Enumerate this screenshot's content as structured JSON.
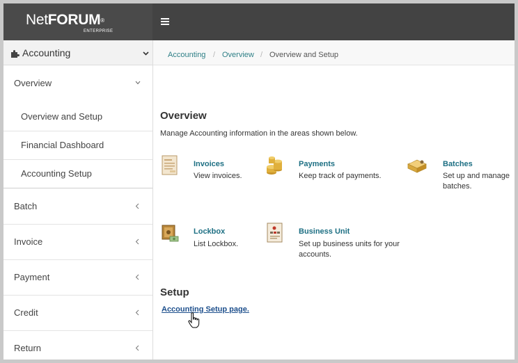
{
  "app": {
    "logo_net": "Net",
    "logo_forum": "FORUM",
    "logo_reg": "®",
    "logo_sub": "ENTERPRISE",
    "menu_icon": "hamburger-icon"
  },
  "sidebar": {
    "module_label": "Accounting",
    "module_icon": "puzzle-icon",
    "overview_label": "Overview",
    "sub_items": [
      {
        "label": "Overview and Setup"
      },
      {
        "label": "Financial Dashboard"
      },
      {
        "label": "Accounting Setup"
      }
    ],
    "items": [
      {
        "label": "Batch"
      },
      {
        "label": "Invoice"
      },
      {
        "label": "Payment"
      },
      {
        "label": "Credit"
      },
      {
        "label": "Return"
      }
    ]
  },
  "breadcrumb": {
    "items": [
      "Accounting",
      "Overview"
    ],
    "separator": "/",
    "current": "Overview and Setup"
  },
  "main": {
    "overview_heading": "Overview",
    "intro": "Manage Accounting information in the areas shown below.",
    "tiles": [
      {
        "title": "Invoices",
        "desc_lines": [
          "View invoices."
        ],
        "icon": "invoice-icon"
      },
      {
        "title": "Payments",
        "desc_lines": [
          "Keep track of payments."
        ],
        "icon": "coins-icon"
      },
      {
        "title": "Batches",
        "desc_lines": [
          "Set up and manage",
          "batches."
        ],
        "icon": "batch-box-icon"
      },
      {
        "title": "Lockbox",
        "desc_lines": [
          "List Lockbox."
        ],
        "icon": "lockbox-icon"
      },
      {
        "title": "Business Unit",
        "desc_lines": [
          "Set up business units for your",
          "accounts."
        ],
        "icon": "business-unit-icon"
      }
    ],
    "setup_heading": "Setup",
    "setup_link": "Accounting Setup page."
  },
  "colors": {
    "topbar": "#434343",
    "link_teal": "#1d6f83",
    "breadcrumb_link": "#2e7f86",
    "setup_link": "#1d4f8c"
  }
}
